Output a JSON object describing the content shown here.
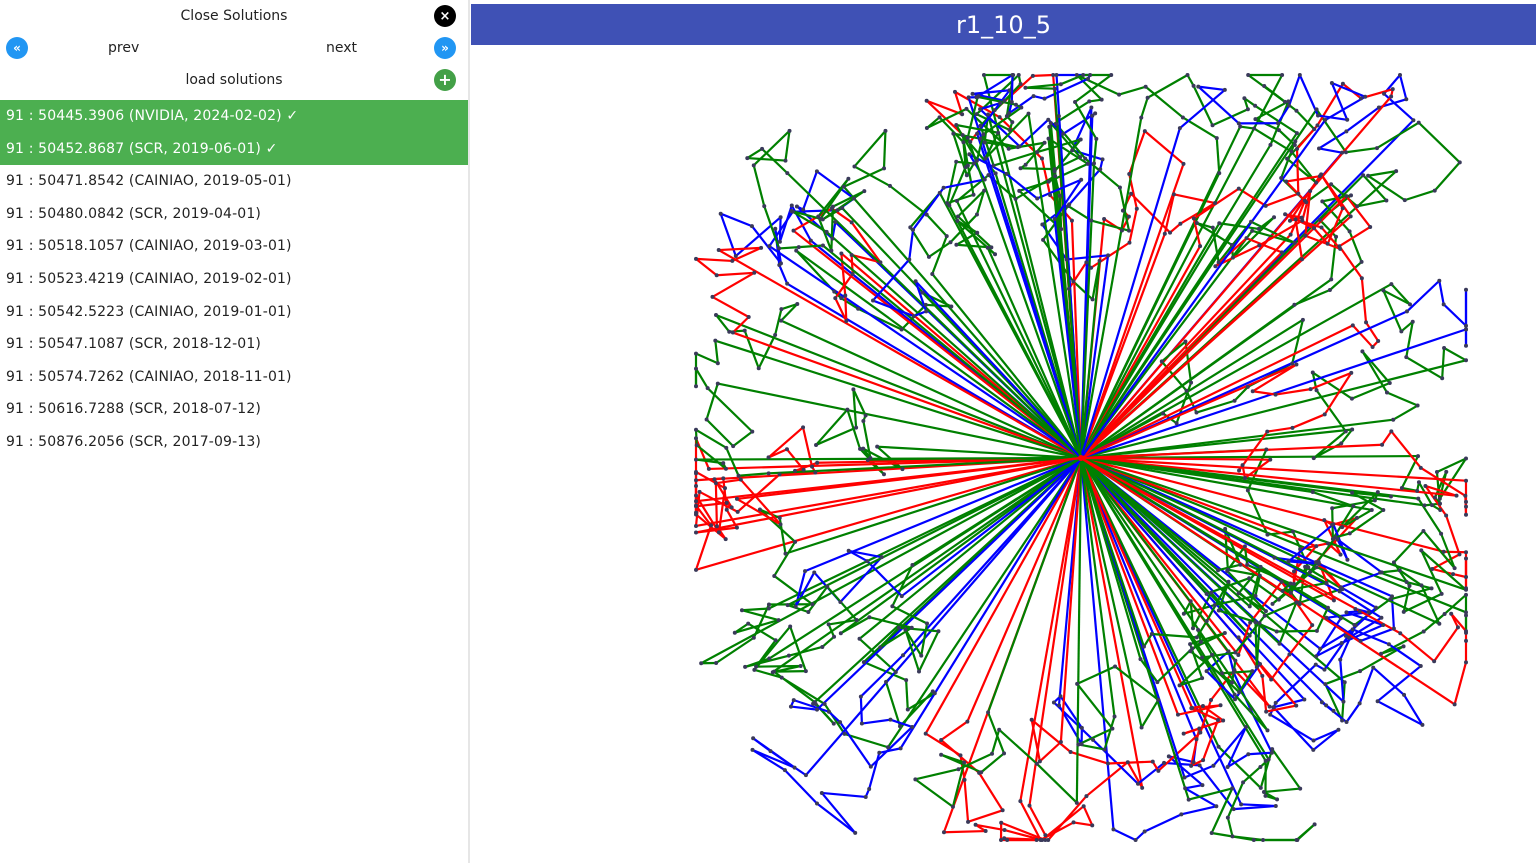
{
  "panel": {
    "close_label": "Close Solutions",
    "close_icon": "×",
    "prev_label": "prev",
    "next_label": "next",
    "prev_icon": "«",
    "next_icon": "»",
    "load_label": "load solutions",
    "add_icon": "+",
    "solutions": [
      {
        "text": "91 : 50445.3906 (NVIDIA, 2024-02-02) ✓",
        "selected": true
      },
      {
        "text": "91 : 50452.8687 (SCR, 2019-06-01) ✓",
        "selected": true
      },
      {
        "text": "91 : 50471.8542 (CAINIAO, 2019-05-01)",
        "selected": false
      },
      {
        "text": "91 : 50480.0842 (SCR, 2019-04-01)",
        "selected": false
      },
      {
        "text": "91 : 50518.1057 (CAINIAO, 2019-03-01)",
        "selected": false
      },
      {
        "text": "91 : 50523.4219 (CAINIAO, 2019-02-01)",
        "selected": false
      },
      {
        "text": "91 : 50542.5223 (CAINIAO, 2019-01-01)",
        "selected": false
      },
      {
        "text": "91 : 50547.1087 (SCR, 2018-12-01)",
        "selected": false
      },
      {
        "text": "91 : 50574.7262 (CAINIAO, 2018-11-01)",
        "selected": false
      },
      {
        "text": "91 : 50616.7288 (SCR, 2018-07-12)",
        "selected": false
      },
      {
        "text": "91 : 50876.2056 (SCR, 2017-09-13)",
        "selected": false
      }
    ]
  },
  "viewer": {
    "instance_title": "r1_10_5",
    "route_count": 91,
    "route_colors": [
      "#008000",
      "#0000ff",
      "#ff0000"
    ],
    "node_color": "#3a3a5a",
    "depot_color": "#ff0000"
  }
}
